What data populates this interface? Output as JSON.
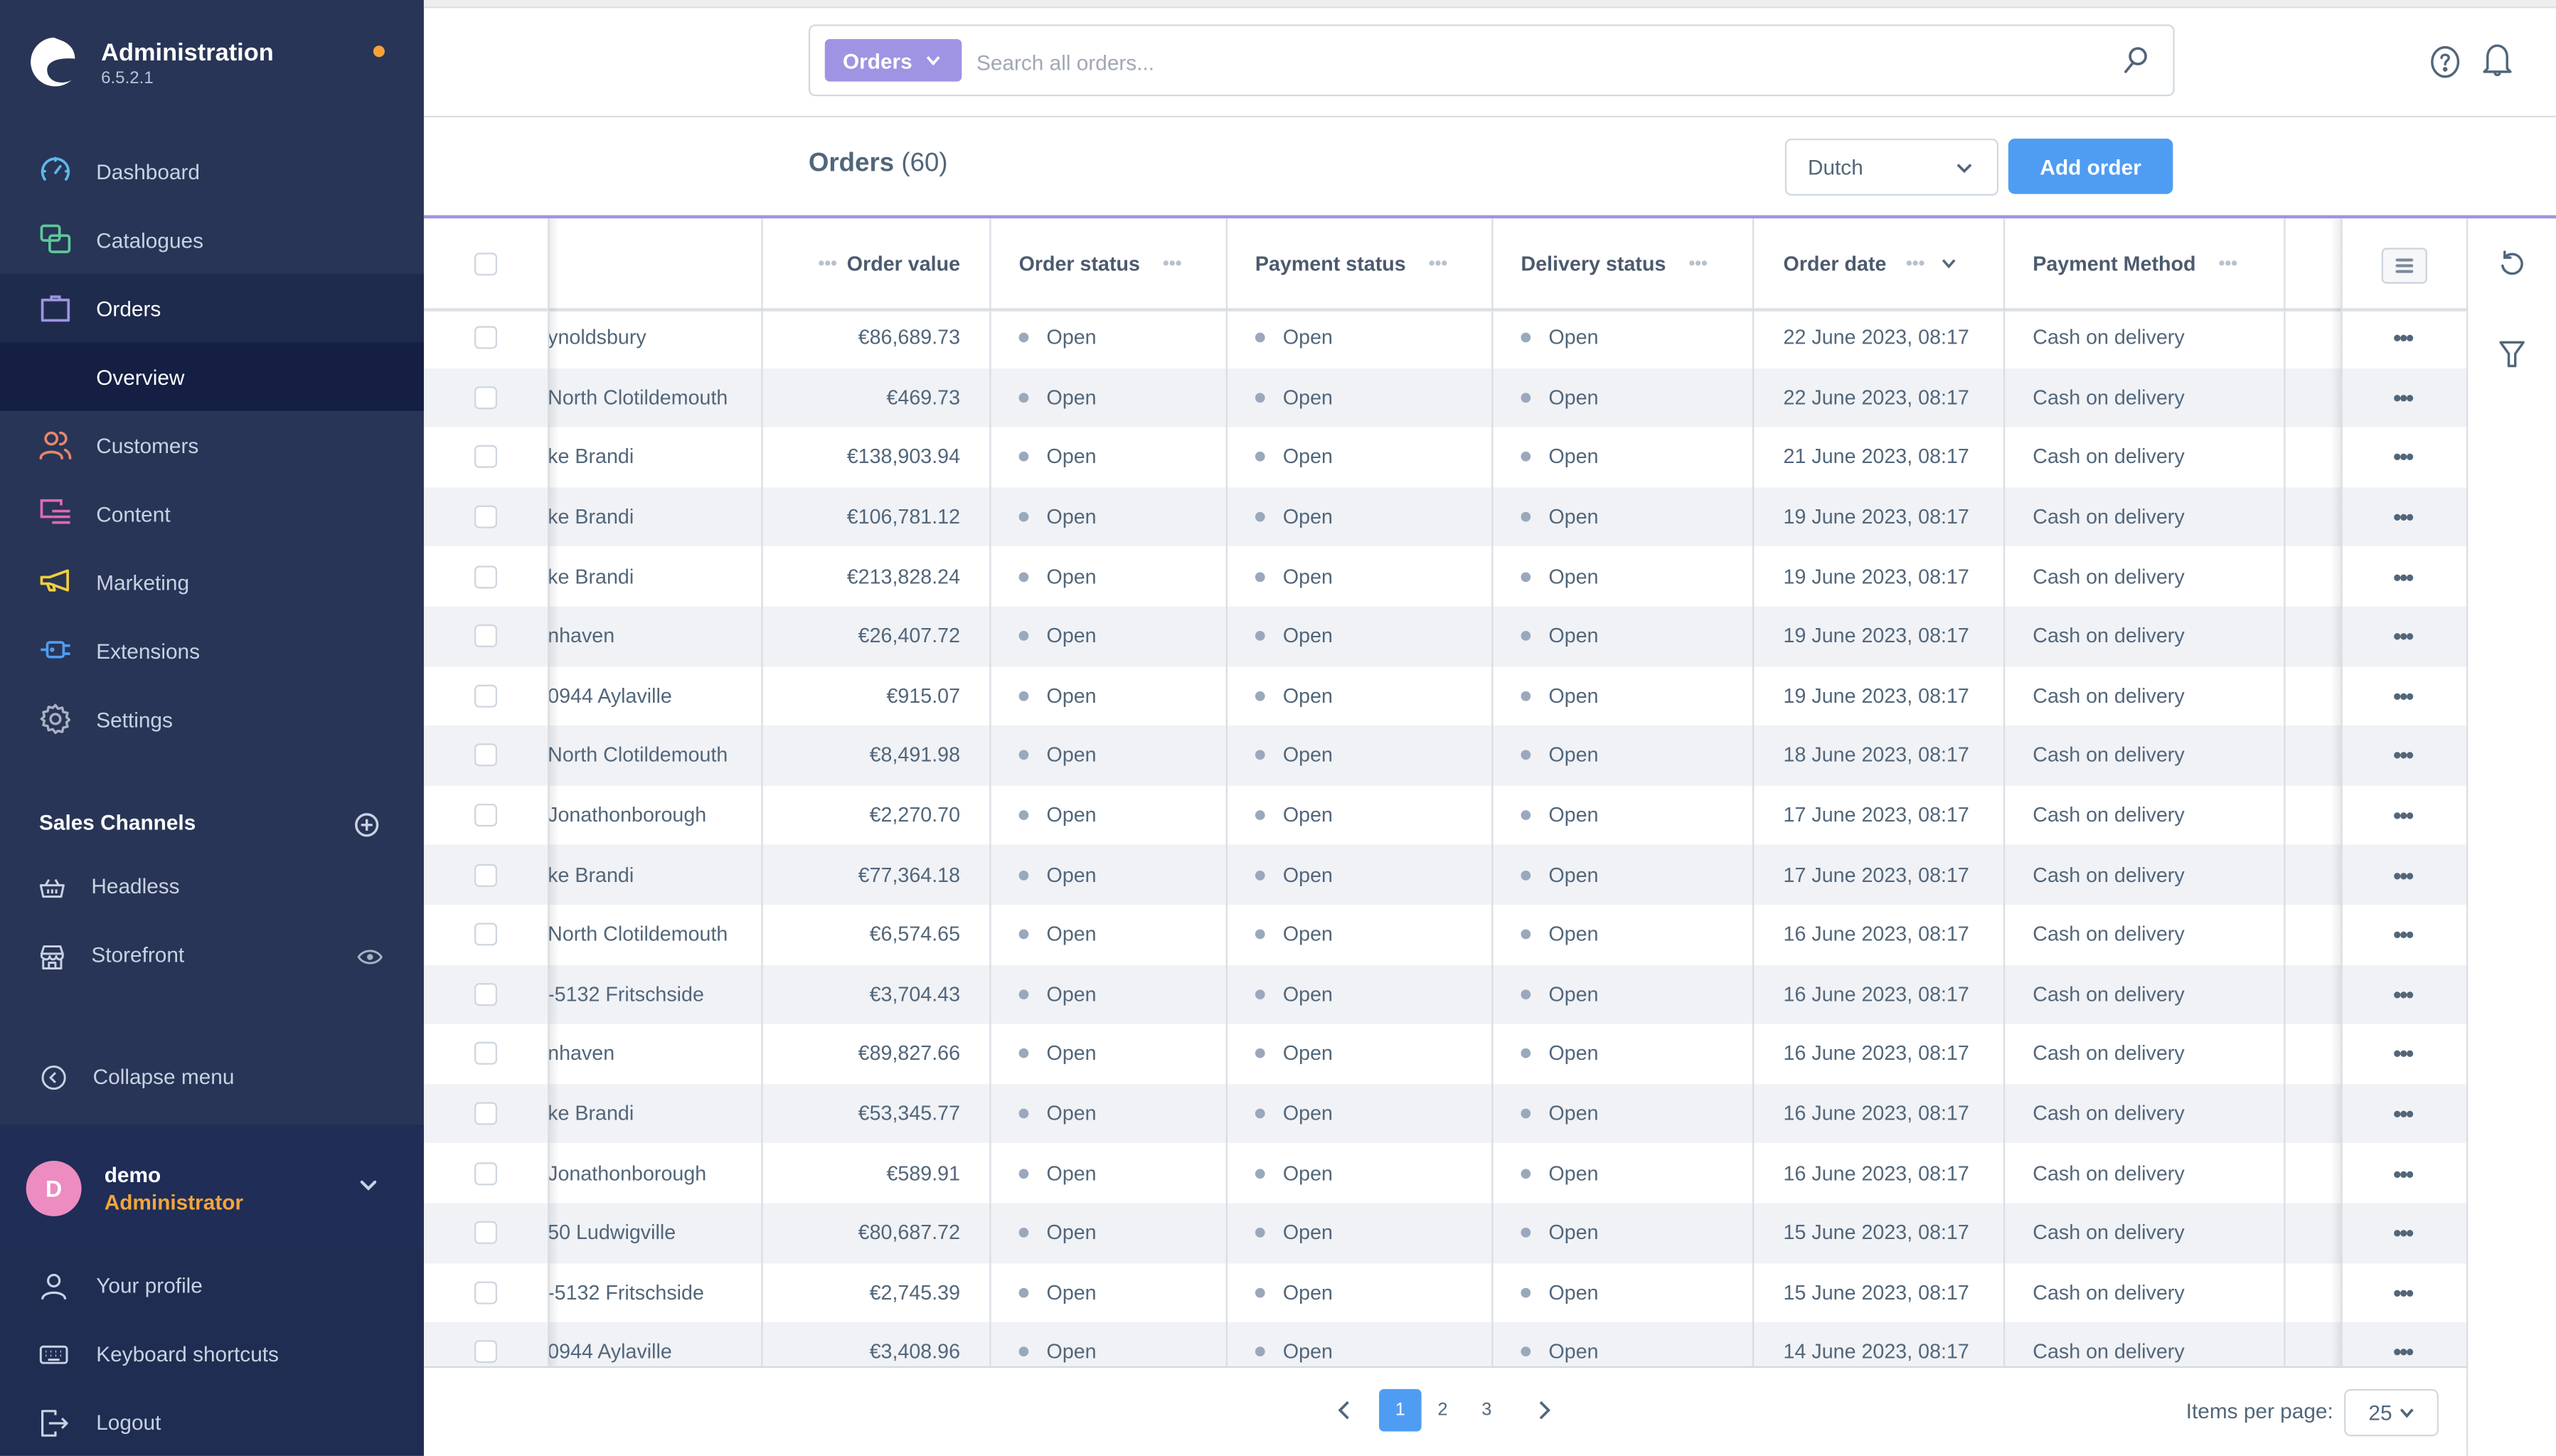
{
  "app": {
    "title": "Administration",
    "version": "6.5.2.1",
    "notification_dot_color": "#f7a23b"
  },
  "sidebar": {
    "items": [
      {
        "label": "Dashboard",
        "icon": "gauge-icon",
        "color": "#5fb8e8"
      },
      {
        "label": "Catalogues",
        "icon": "catalogue-icon",
        "color": "#5fc79a"
      },
      {
        "label": "Orders",
        "icon": "shopping-bag-icon",
        "color": "#9f94e3",
        "active": true
      },
      {
        "label": "Overview",
        "sub": true,
        "active": true
      },
      {
        "label": "Customers",
        "icon": "users-icon",
        "color": "#e7876a"
      },
      {
        "label": "Content",
        "icon": "content-icon",
        "color": "#e06ab0"
      },
      {
        "label": "Marketing",
        "icon": "megaphone-icon",
        "color": "#f2cf3c"
      },
      {
        "label": "Extensions",
        "icon": "plug-icon",
        "color": "#4f9df2"
      },
      {
        "label": "Settings",
        "icon": "gear-icon",
        "color": "#a8b2c4"
      }
    ],
    "sales_channels": {
      "title": "Sales Channels",
      "items": [
        {
          "label": "Headless",
          "icon": "basket-icon"
        },
        {
          "label": "Storefront",
          "icon": "storefront-icon",
          "has_eye": true
        }
      ]
    },
    "collapse_label": "Collapse menu",
    "user": {
      "initial": "D",
      "name": "demo",
      "role": "Administrator",
      "avatar_color": "#ec8cc0"
    },
    "user_menu": [
      {
        "label": "Your profile",
        "icon": "user-icon"
      },
      {
        "label": "Keyboard shortcuts",
        "icon": "keyboard-icon"
      },
      {
        "label": "Logout",
        "icon": "logout-icon"
      }
    ]
  },
  "search": {
    "type_label": "Orders",
    "placeholder": "Search all orders...",
    "value": ""
  },
  "page": {
    "title": "Orders",
    "count": "(60)",
    "language": "Dutch",
    "add_button": "Add order",
    "accent_color": "#9f94e3",
    "primary_color": "#4f9df2"
  },
  "table": {
    "columns": [
      {
        "key": "customer",
        "label": ""
      },
      {
        "key": "value",
        "label": "Order value"
      },
      {
        "key": "order_status",
        "label": "Order status"
      },
      {
        "key": "payment_status",
        "label": "Payment status"
      },
      {
        "key": "delivery_status",
        "label": "Delivery status"
      },
      {
        "key": "date",
        "label": "Order date"
      },
      {
        "key": "payment_method",
        "label": "Payment Method"
      }
    ],
    "status_dot_color": "#9aa8bc",
    "rows": [
      {
        "customer": "ynoldsbury",
        "value": "€86,689.73",
        "order_status": "Open",
        "payment_status": "Open",
        "delivery_status": "Open",
        "date": "22 June 2023, 08:17",
        "payment_method": "Cash on delivery"
      },
      {
        "customer": "North Clotildemouth",
        "value": "€469.73",
        "order_status": "Open",
        "payment_status": "Open",
        "delivery_status": "Open",
        "date": "22 June 2023, 08:17",
        "payment_method": "Cash on delivery"
      },
      {
        "customer": "ke Brandi",
        "value": "€138,903.94",
        "order_status": "Open",
        "payment_status": "Open",
        "delivery_status": "Open",
        "date": "21 June 2023, 08:17",
        "payment_method": "Cash on delivery"
      },
      {
        "customer": "ke Brandi",
        "value": "€106,781.12",
        "order_status": "Open",
        "payment_status": "Open",
        "delivery_status": "Open",
        "date": "19 June 2023, 08:17",
        "payment_method": "Cash on delivery"
      },
      {
        "customer": "ke Brandi",
        "value": "€213,828.24",
        "order_status": "Open",
        "payment_status": "Open",
        "delivery_status": "Open",
        "date": "19 June 2023, 08:17",
        "payment_method": "Cash on delivery"
      },
      {
        "customer": "nhaven",
        "value": "€26,407.72",
        "order_status": "Open",
        "payment_status": "Open",
        "delivery_status": "Open",
        "date": "19 June 2023, 08:17",
        "payment_method": "Cash on delivery"
      },
      {
        "customer": "0944 Aylaville",
        "value": "€915.07",
        "order_status": "Open",
        "payment_status": "Open",
        "delivery_status": "Open",
        "date": "19 June 2023, 08:17",
        "payment_method": "Cash on delivery"
      },
      {
        "customer": "North Clotildemouth",
        "value": "€8,491.98",
        "order_status": "Open",
        "payment_status": "Open",
        "delivery_status": "Open",
        "date": "18 June 2023, 08:17",
        "payment_method": "Cash on delivery"
      },
      {
        "customer": "Jonathonborough",
        "value": "€2,270.70",
        "order_status": "Open",
        "payment_status": "Open",
        "delivery_status": "Open",
        "date": "17 June 2023, 08:17",
        "payment_method": "Cash on delivery"
      },
      {
        "customer": "ke Brandi",
        "value": "€77,364.18",
        "order_status": "Open",
        "payment_status": "Open",
        "delivery_status": "Open",
        "date": "17 June 2023, 08:17",
        "payment_method": "Cash on delivery"
      },
      {
        "customer": "North Clotildemouth",
        "value": "€6,574.65",
        "order_status": "Open",
        "payment_status": "Open",
        "delivery_status": "Open",
        "date": "16 June 2023, 08:17",
        "payment_method": "Cash on delivery"
      },
      {
        "customer": "-5132 Fritschside",
        "value": "€3,704.43",
        "order_status": "Open",
        "payment_status": "Open",
        "delivery_status": "Open",
        "date": "16 June 2023, 08:17",
        "payment_method": "Cash on delivery"
      },
      {
        "customer": "nhaven",
        "value": "€89,827.66",
        "order_status": "Open",
        "payment_status": "Open",
        "delivery_status": "Open",
        "date": "16 June 2023, 08:17",
        "payment_method": "Cash on delivery"
      },
      {
        "customer": "ke Brandi",
        "value": "€53,345.77",
        "order_status": "Open",
        "payment_status": "Open",
        "delivery_status": "Open",
        "date": "16 June 2023, 08:17",
        "payment_method": "Cash on delivery"
      },
      {
        "customer": "Jonathonborough",
        "value": "€589.91",
        "order_status": "Open",
        "payment_status": "Open",
        "delivery_status": "Open",
        "date": "16 June 2023, 08:17",
        "payment_method": "Cash on delivery"
      },
      {
        "customer": "50 Ludwigville",
        "value": "€80,687.72",
        "order_status": "Open",
        "payment_status": "Open",
        "delivery_status": "Open",
        "date": "15 June 2023, 08:17",
        "payment_method": "Cash on delivery"
      },
      {
        "customer": "-5132 Fritschside",
        "value": "€2,745.39",
        "order_status": "Open",
        "payment_status": "Open",
        "delivery_status": "Open",
        "date": "15 June 2023, 08:17",
        "payment_method": "Cash on delivery"
      },
      {
        "customer": "0944 Aylaville",
        "value": "€3,408.96",
        "order_status": "Open",
        "payment_status": "Open",
        "delivery_status": "Open",
        "date": "14 June 2023, 08:17",
        "payment_method": "Cash on delivery"
      }
    ]
  },
  "pagination": {
    "pages": [
      "1",
      "2",
      "3"
    ],
    "current_page": "1",
    "items_per_page_label": "Items per page:",
    "items_per_page": "25"
  }
}
